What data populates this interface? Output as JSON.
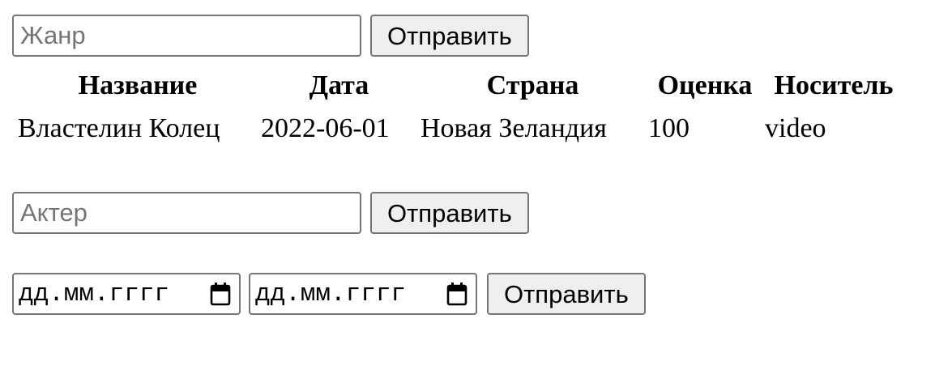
{
  "genre_form": {
    "input_value": "",
    "input_placeholder": "Жанр",
    "submit_label": "Отправить"
  },
  "films_table": {
    "headers": [
      "Название",
      "Дата",
      "Страна",
      "Оценка",
      "Носитель"
    ],
    "rows": [
      [
        "Властелин Колец",
        "2022-06-01",
        "Новая Зеландия",
        "100",
        "video"
      ]
    ]
  },
  "actor_form": {
    "input_value": "",
    "input_placeholder": "Актер",
    "submit_label": "Отправить"
  },
  "date_form": {
    "date_from_placeholder": "дд.мм.гггг",
    "date_to_placeholder": "дд.мм.гггг",
    "submit_label": "Отправить"
  },
  "icons": {
    "date_picker": "calendar-icon"
  },
  "colors": {
    "input_border": "#767676",
    "button_background": "#efefef",
    "placeholder": "#757575"
  }
}
